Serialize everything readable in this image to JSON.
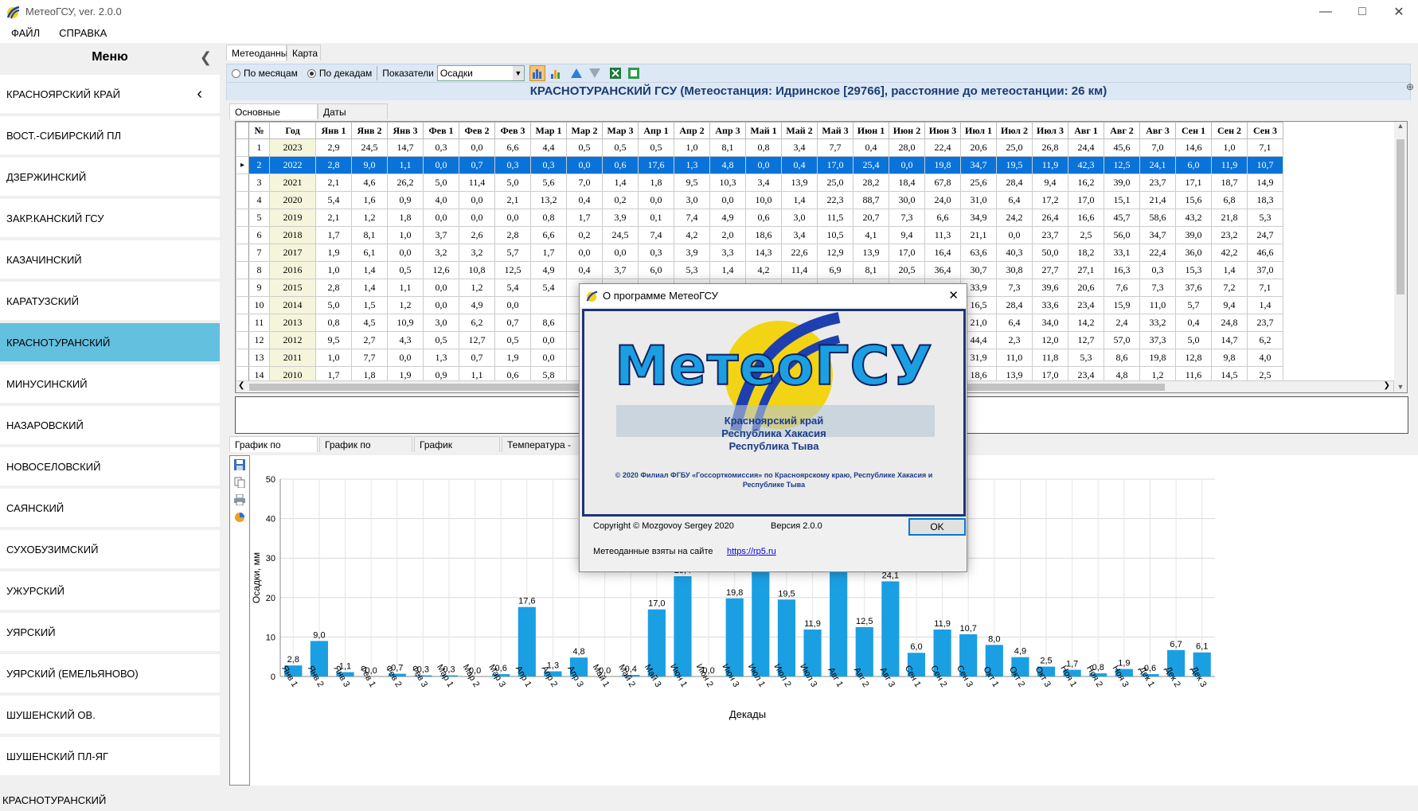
{
  "window": {
    "title": "МетеоГСУ, ver. 2.0.0"
  },
  "menubar": [
    "ФАЙЛ",
    "СПРАВКА"
  ],
  "sidebar": {
    "title": "Меню",
    "items": [
      "КРАСНОЯРСКИЙ КРАЙ",
      "ВОСТ.-СИБИРСКИЙ ПЛ",
      "ДЗЕРЖИНСКИЙ",
      "ЗАКР.КАНСКИЙ ГСУ",
      "КАЗАЧИНСКИЙ",
      "КАРАТУЗСКИЙ",
      "КРАСНОТУРАНСКИЙ",
      "МИНУСИНСКИЙ",
      "НАЗАРОВСКИЙ",
      "НОВОСЕЛОВСКИЙ",
      "САЯНСКИЙ",
      "СУХОБУЗИМСКИЙ",
      "УЖУРСКИЙ",
      "УЯРСКИЙ",
      "УЯРСКИЙ (ЕМЕЛЬЯНОВО)",
      "ШУШЕНСКИЙ ОВ.",
      "ШУШЕНСКИЙ ПЛ-ЯГ"
    ],
    "selected": 6
  },
  "status": "КРАСНОТУРАНСКИЙ",
  "tabs": [
    "Метеоданные",
    "Карта"
  ],
  "toolbar": {
    "by_month": "По месяцам",
    "by_decade": "По декадам",
    "indicators_label": "Показатели",
    "indicator_value": "Осадки"
  },
  "header": "КРАСНОТУРАНСКИЙ ГСУ (Метеостанция: Идринское [29766], расстояние до метеостанции: 26 км)",
  "subtabs": [
    "Основные показатели",
    "Даты перехода"
  ],
  "table": {
    "columns": [
      "№",
      "Год",
      "Янв 1",
      "Янв 2",
      "Янв 3",
      "Фев 1",
      "Фев 2",
      "Фев 3",
      "Мар 1",
      "Мар 2",
      "Мар 3",
      "Апр 1",
      "Апр 2",
      "Апр 3",
      "Май 1",
      "Май 2",
      "Май 3",
      "Июн 1",
      "Июн 2",
      "Июн 3",
      "Июл 1",
      "Июл 2",
      "Июл 3",
      "Авг 1",
      "Авг 2",
      "Авг 3",
      "Сен 1",
      "Сен 2",
      "Сен 3"
    ],
    "selected_row": 1,
    "rows": [
      [
        "1",
        "2023",
        "2,9",
        "24,5",
        "14,7",
        "0,3",
        "0,0",
        "6,6",
        "4,4",
        "0,5",
        "0,5",
        "0,5",
        "1,0",
        "8,1",
        "0,8",
        "3,4",
        "7,7",
        "0,4",
        "28,0",
        "22,4",
        "20,6",
        "25,0",
        "26,8",
        "24,4",
        "45,6",
        "7,0",
        "14,6",
        "1,0",
        "7,1"
      ],
      [
        "2",
        "2022",
        "2,8",
        "9,0",
        "1,1",
        "0,0",
        "0,7",
        "0,3",
        "0,3",
        "0,0",
        "0,6",
        "17,6",
        "1,3",
        "4,8",
        "0,0",
        "0,4",
        "17,0",
        "25,4",
        "0,0",
        "19,8",
        "34,7",
        "19,5",
        "11,9",
        "42,3",
        "12,5",
        "24,1",
        "6,0",
        "11,9",
        "10,7"
      ],
      [
        "3",
        "2021",
        "2,1",
        "4,6",
        "26,2",
        "5,0",
        "11,4",
        "5,0",
        "5,6",
        "7,0",
        "1,4",
        "1,8",
        "9,5",
        "10,3",
        "3,4",
        "13,9",
        "25,0",
        "28,2",
        "18,4",
        "67,8",
        "25,6",
        "28,4",
        "9,4",
        "16,2",
        "39,0",
        "23,7",
        "17,1",
        "18,7",
        "14,9"
      ],
      [
        "4",
        "2020",
        "5,4",
        "1,6",
        "0,9",
        "4,0",
        "0,0",
        "2,1",
        "13,2",
        "0,4",
        "0,2",
        "0,0",
        "3,0",
        "0,0",
        "10,0",
        "1,4",
        "22,3",
        "88,7",
        "30,0",
        "24,0",
        "31,0",
        "6,4",
        "17,2",
        "17,0",
        "15,1",
        "21,4",
        "15,6",
        "6,8",
        "18,3"
      ],
      [
        "5",
        "2019",
        "2,1",
        "1,2",
        "1,8",
        "0,0",
        "0,0",
        "0,0",
        "0,8",
        "1,7",
        "3,9",
        "0,1",
        "7,4",
        "4,9",
        "0,6",
        "3,0",
        "11,5",
        "20,7",
        "7,3",
        "6,6",
        "34,9",
        "24,2",
        "26,4",
        "16,6",
        "45,7",
        "58,6",
        "43,2",
        "21,8",
        "5,3"
      ],
      [
        "6",
        "2018",
        "1,7",
        "8,1",
        "1,0",
        "3,7",
        "2,6",
        "2,8",
        "6,6",
        "0,2",
        "24,5",
        "7,4",
        "4,2",
        "2,0",
        "18,6",
        "3,4",
        "10,5",
        "4,1",
        "9,4",
        "11,3",
        "21,1",
        "0,0",
        "23,7",
        "2,5",
        "56,0",
        "34,7",
        "39,0",
        "23,2",
        "24,7"
      ],
      [
        "7",
        "2017",
        "1,9",
        "6,1",
        "0,0",
        "3,2",
        "3,2",
        "5,7",
        "1,7",
        "0,0",
        "0,0",
        "0,3",
        "3,9",
        "3,3",
        "14,3",
        "22,6",
        "12,9",
        "13,9",
        "17,0",
        "16,4",
        "63,6",
        "40,3",
        "50,0",
        "18,2",
        "33,1",
        "22,4",
        "36,0",
        "42,2",
        "46,6"
      ],
      [
        "8",
        "2016",
        "1,0",
        "1,4",
        "0,5",
        "12,6",
        "10,8",
        "12,5",
        "4,9",
        "0,4",
        "3,7",
        "6,0",
        "5,3",
        "1,4",
        "4,2",
        "11,4",
        "6,9",
        "8,1",
        "20,5",
        "36,4",
        "30,7",
        "30,8",
        "27,7",
        "27,1",
        "16,3",
        "0,3",
        "15,3",
        "1,4",
        "37,0"
      ],
      [
        "9",
        "2015",
        "2,8",
        "1,4",
        "1,1",
        "0,0",
        "1,2",
        "5,4",
        "5,4",
        "",
        "",
        "",
        "",
        "",
        "",
        "",
        "",
        "",
        "1,3",
        "0,0",
        "33,9",
        "7,3",
        "39,6",
        "20,6",
        "7,6",
        "7,3",
        "37,6",
        "7,2",
        "7,1"
      ],
      [
        "10",
        "2014",
        "5,0",
        "1,5",
        "1,2",
        "0,0",
        "4,9",
        "0,0",
        "",
        "",
        "",
        "",
        "",
        "",
        "",
        "",
        "",
        "",
        "0,7",
        "20,9",
        "16,5",
        "28,4",
        "33,6",
        "23,4",
        "15,9",
        "11,0",
        "5,7",
        "9,4",
        "1,4"
      ],
      [
        "11",
        "2013",
        "0,8",
        "4,5",
        "10,9",
        "3,0",
        "6,2",
        "0,7",
        "8,6",
        "",
        "",
        "",
        "",
        "",
        "",
        "",
        "",
        "",
        "3,1",
        "12,3",
        "21,0",
        "6,4",
        "34,0",
        "14,2",
        "2,4",
        "33,2",
        "0,4",
        "24,8",
        "23,7"
      ],
      [
        "12",
        "2012",
        "9,5",
        "2,7",
        "4,3",
        "0,5",
        "12,7",
        "0,5",
        "0,0",
        "",
        "",
        "",
        "",
        "",
        "",
        "",
        "",
        "",
        "0,0",
        "0,8",
        "44,4",
        "2,3",
        "12,0",
        "12,7",
        "57,0",
        "37,3",
        "5,0",
        "14,7",
        "6,2"
      ],
      [
        "13",
        "2011",
        "1,0",
        "7,7",
        "0,0",
        "1,3",
        "0,7",
        "1,9",
        "0,0",
        "",
        "",
        "",
        "",
        "",
        "",
        "",
        "",
        "",
        "3,0",
        "64,0",
        "31,9",
        "11,0",
        "11,8",
        "5,3",
        "8,6",
        "19,8",
        "12,8",
        "9,8",
        "4,0"
      ],
      [
        "14",
        "2010",
        "1,7",
        "1,8",
        "1,9",
        "0,9",
        "1,1",
        "0,6",
        "5,8",
        "",
        "",
        "",
        "",
        "",
        "",
        "",
        "",
        "",
        "4,1",
        "26,3",
        "18,6",
        "13,9",
        "17,0",
        "23,4",
        "4,8",
        "1,2",
        "11,6",
        "14,5",
        "2,5"
      ]
    ]
  },
  "chart_tabs": [
    "График по строкам",
    "График по столбцам",
    "График температур",
    "Температура - Ос"
  ],
  "chart_data": {
    "type": "bar",
    "xlabel": "Декады",
    "ylabel": "Осадки, мм",
    "ylim": [
      0,
      50
    ],
    "yticks": [
      "0",
      "10",
      "20",
      "30",
      "40",
      "50"
    ],
    "categories": [
      "Янв 1",
      "Янв 2",
      "Янв 3",
      "Фев 1",
      "Фев 2",
      "Фев 3",
      "Мар 1",
      "Мар 2",
      "Мар 3",
      "Апр 1",
      "Апр 2",
      "Апр 3",
      "Май 1",
      "Май 2",
      "Май 3",
      "Июн 1",
      "Июн 2",
      "Июн 3",
      "Июл 1",
      "Июл 2",
      "Июл 3",
      "Авг 1",
      "Авг 2",
      "Авг 3",
      "Сен 1",
      "Сен 2",
      "Сен 3",
      "Окт 1",
      "Окт 2",
      "Окт 3",
      "Ноя 1",
      "Ноя 2",
      "Ноя 3",
      "Дек 1",
      "Дек 2",
      "Дек 3"
    ],
    "values": [
      2.8,
      9.0,
      1.1,
      0.0,
      0.7,
      0.3,
      0.3,
      0.0,
      0.6,
      17.6,
      1.3,
      4.8,
      0.0,
      0.4,
      17.0,
      25.4,
      0.0,
      19.8,
      34.7,
      19.5,
      11.9,
      42.3,
      12.5,
      24.1,
      6.0,
      11.9,
      10.7,
      8.0,
      4.9,
      2.5,
      1.7,
      0.8,
      1.9,
      0.6,
      6.7,
      6.1
    ],
    "labels": [
      "2,8",
      "9,0",
      "1,1",
      "0,0",
      "0,7",
      "0,3",
      "0,3",
      "0,0",
      "0,6",
      "17,6",
      "1,3",
      "4,8",
      "0,0",
      "0,4",
      "17,0",
      "25,4",
      "0,0",
      "19,8",
      "34,7",
      "19,5",
      "11,9",
      "42,3",
      "12,5",
      "24,1",
      "6,0",
      "11,9",
      "10,7",
      "8,0",
      "4,9",
      "2,5",
      "1,7",
      "0,8",
      "1,9",
      "0,6",
      "6,7",
      "6,1"
    ],
    "color": "#1b9fe3",
    "grid": true
  },
  "dialog": {
    "title": "О программе МетеоГСУ",
    "logo_text": "МетеоГСУ",
    "region1": "Красноярский край",
    "region2": "Республика Хакасия",
    "region3": "Республика Тыва",
    "copyright_org": "© 2020 Филиал ФГБУ «Госсорткомиссия» по Красноярскому краю, Республике Хакасия и Республике Тыва",
    "copyright": "Copyright © Mozgovoy Sergey 2020",
    "version": "Версия 2.0.0",
    "ok": "OK",
    "source_label": "Метеоданные взяты на сайте",
    "link": "https://rp5.ru"
  },
  "colors": {
    "accent": "#1b9fe3",
    "selected_nav": "#63c0de",
    "selected_row": "#0a73d9",
    "header_text": "#1c3c72"
  }
}
